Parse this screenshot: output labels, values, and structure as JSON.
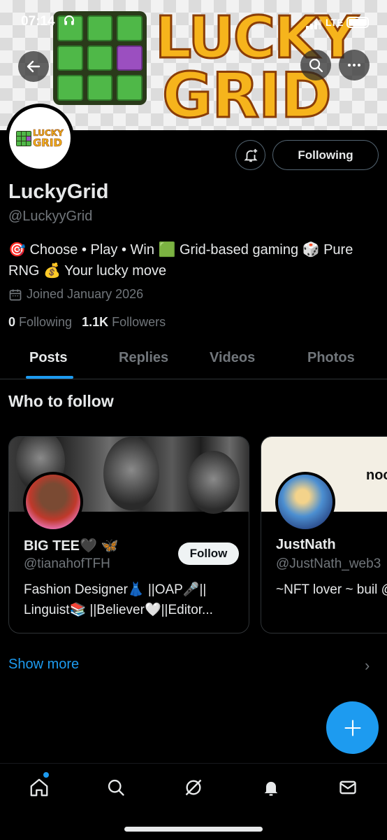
{
  "status_bar": {
    "time": "07:14",
    "network": "LTE"
  },
  "banner": {
    "line1": "LUCKY",
    "line2": "GRID"
  },
  "avatar": {
    "line1": "LUCKY",
    "line2": "GRID"
  },
  "profile": {
    "following_button": "Following",
    "name": "LuckyGrid",
    "handle": "@LuckyyGrid",
    "bio": "🎯 Choose • Play • Win 🟩 Grid-based gaming 🎲 Pure RNG 💰 Your lucky move",
    "joined": "Joined January 2026",
    "following_count": "0",
    "following_label": "Following",
    "followers_count": "1.1K",
    "followers_label": "Followers"
  },
  "tabs": [
    "Posts",
    "Replies",
    "Videos",
    "Photos"
  ],
  "who_to_follow": {
    "title": "Who to follow",
    "cards": [
      {
        "name": "BIG TEE🖤 🦋",
        "handle": "@tianahofTFH",
        "bio": "Fashion Designer👗 ||OAP🎤|| Linguist📚 ||Believer🤍||Editor...",
        "button": "Follow"
      },
      {
        "name": "JustNath",
        "handle": "@JustNath_web3",
        "bio": "~NFT lover ~ buil @daonoobs ~Re",
        "cover_text": "noo"
      }
    ],
    "show_more": "Show more"
  },
  "colors": {
    "accent": "#1d9bf0",
    "muted": "#71767b",
    "text": "#e7e9ea",
    "banner_yellow": "#f6b41c",
    "banner_green": "#4fb848",
    "banner_purple": "#9b4fc0"
  },
  "icons": {
    "back": "arrow-left-icon",
    "search": "search-icon",
    "more": "more-horizontal-icon",
    "bell": "bell-plus-icon",
    "calendar": "calendar-icon",
    "fab": "plus-icon",
    "nav": [
      "home-icon",
      "search-icon",
      "grok-icon",
      "notifications-icon",
      "messages-icon"
    ]
  }
}
